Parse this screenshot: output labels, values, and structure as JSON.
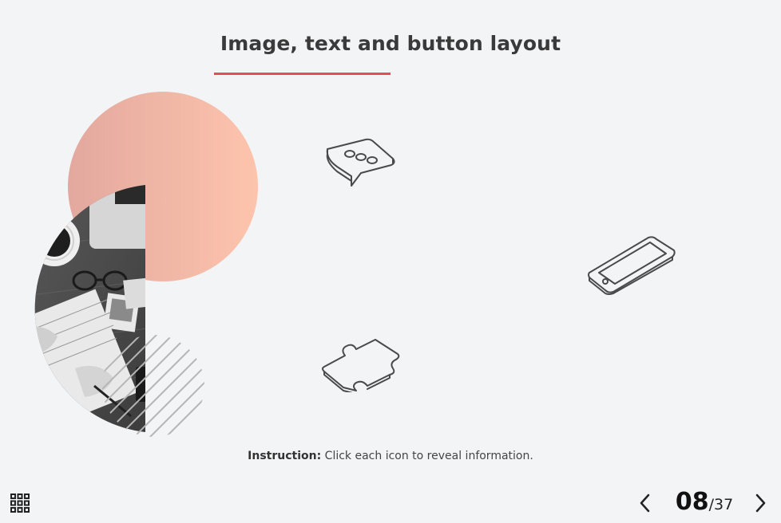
{
  "slide": {
    "title": "Image, text and button layout"
  },
  "instruction": {
    "label": "Instruction:",
    "text": " Click each icon to reveal information."
  },
  "hotspots": [
    {
      "icon": "speech-bubble-icon"
    },
    {
      "icon": "smartphone-icon"
    },
    {
      "icon": "puzzle-piece-icon"
    }
  ],
  "navigation": {
    "current_page": "08",
    "total_pages": "/37",
    "menu_icon": "grid-menu-icon",
    "prev_icon": "chevron-left-icon",
    "next_icon": "chevron-right-icon"
  },
  "colors": {
    "background": "#f3f4f6",
    "accent": "#d9534f",
    "circle_gradient_start": "#e3a89e",
    "circle_gradient_end": "#fdc4ad",
    "icon_stroke": "#4a4a4a"
  }
}
